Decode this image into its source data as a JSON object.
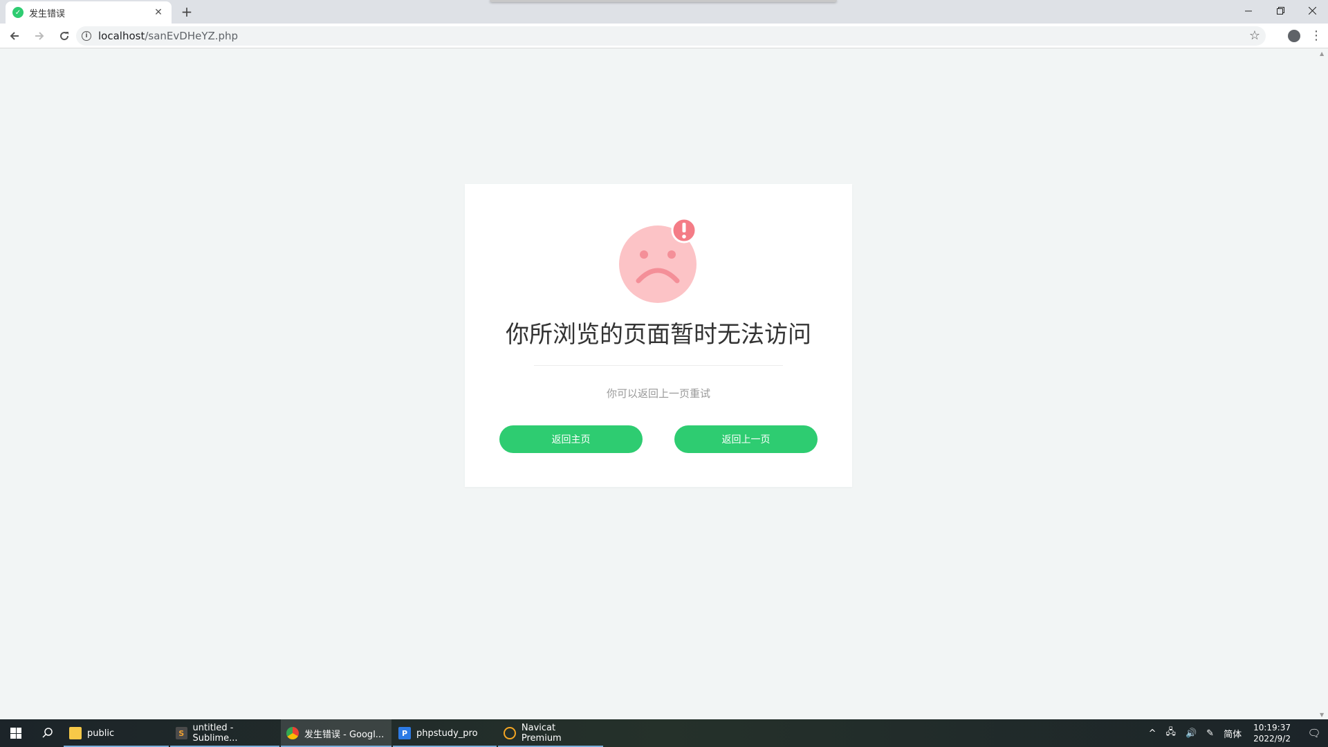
{
  "browser": {
    "tab_title": "发生错误",
    "tab_close": "✕",
    "new_tab": "+",
    "url_host": "localhost",
    "url_path": "/sanEvDHeYZ.php"
  },
  "page": {
    "title": "你所浏览的页面暂时无法访问",
    "subtitle": "你可以返回上一页重试",
    "home_button": "返回主页",
    "back_button": "返回上一页"
  },
  "taskbar": {
    "items": [
      {
        "label": "public",
        "icon": "folder-icon"
      },
      {
        "label": "untitled - Sublime...",
        "icon": "sublime-icon"
      },
      {
        "label": "发生错误 - Googl...",
        "icon": "chrome-icon"
      },
      {
        "label": "phpstudy_pro",
        "icon": "phpstudy-icon"
      },
      {
        "label": "Navicat Premium",
        "icon": "navicat-icon"
      }
    ],
    "ime": "简体",
    "time": "10:19:37",
    "date": "2022/9/2"
  },
  "colors": {
    "accent": "#2ecc71",
    "face": "#fcc3c6",
    "alert": "#f47c86"
  }
}
